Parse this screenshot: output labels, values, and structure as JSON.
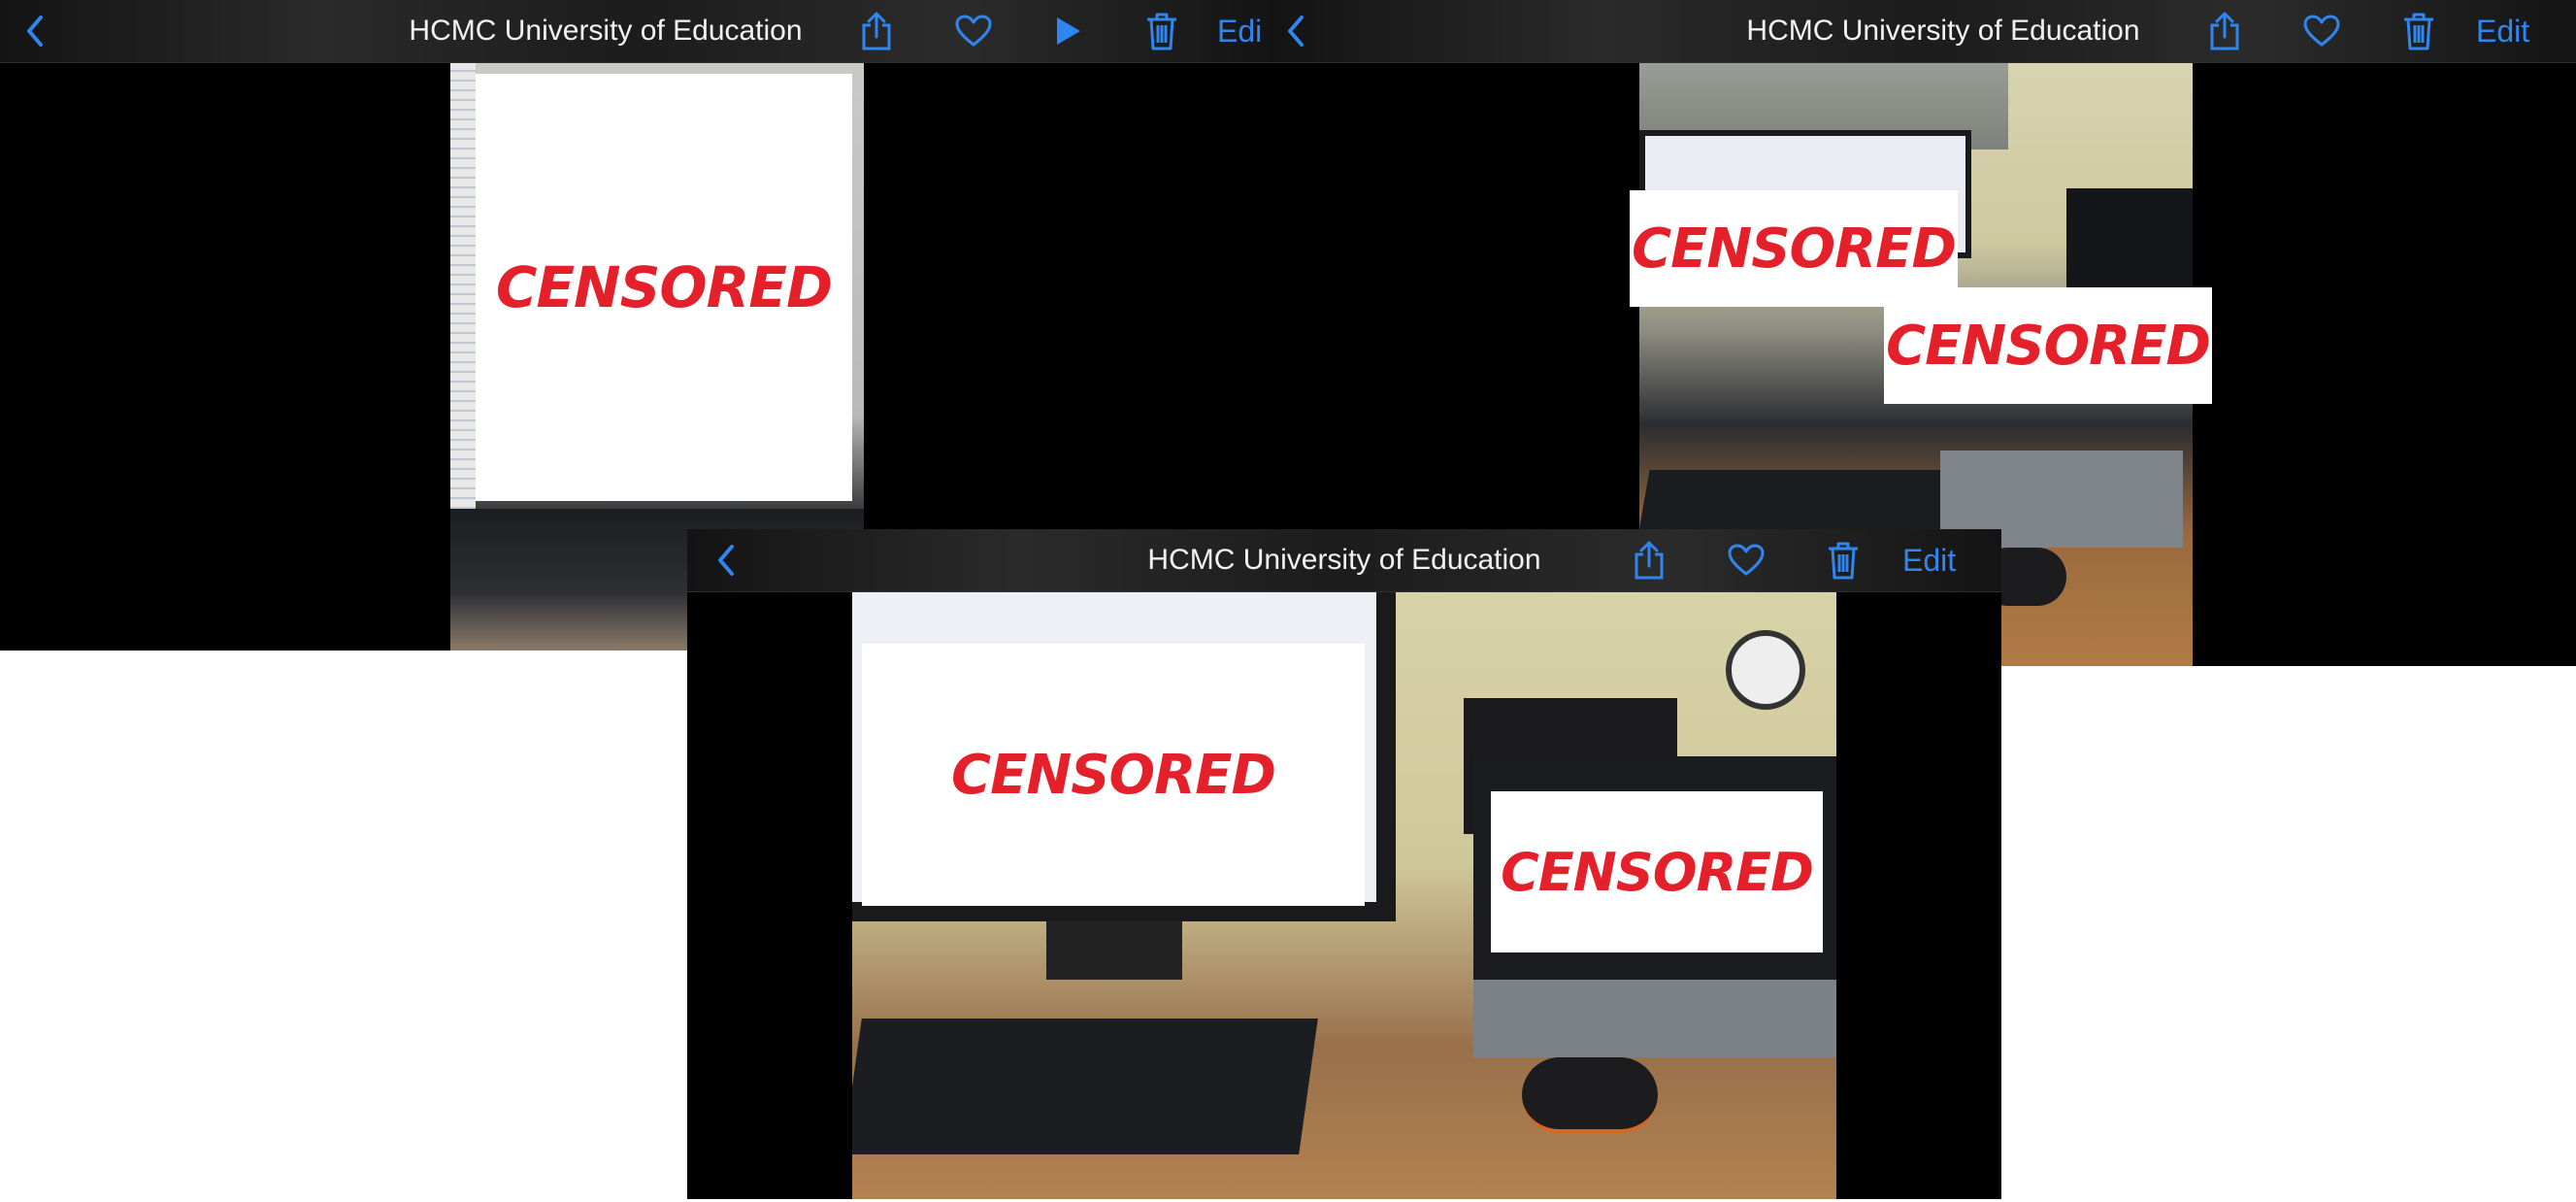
{
  "screens": [
    {
      "title": "HCMC University of Education",
      "edit_label": "Edi",
      "censor_labels": [
        "CENSORED"
      ],
      "has_play": true
    },
    {
      "title": "HCMC University of Education",
      "edit_label": "Edit",
      "censor_labels": [
        "CENSORED",
        "CENSORED"
      ],
      "has_play": false
    },
    {
      "title": "HCMC University of Education",
      "edit_label": "Edit",
      "censor_labels": [
        "CENSORED",
        "CENSORED"
      ],
      "has_play": false
    }
  ],
  "icons": {
    "back": "chevron-left-icon",
    "share": "share-icon",
    "favorite": "heart-icon",
    "play": "play-icon",
    "delete": "trash-icon"
  },
  "colors": {
    "accent": "#2f86f0",
    "censor_text": "#e4202a",
    "bar_background": "#1e1e1e"
  }
}
